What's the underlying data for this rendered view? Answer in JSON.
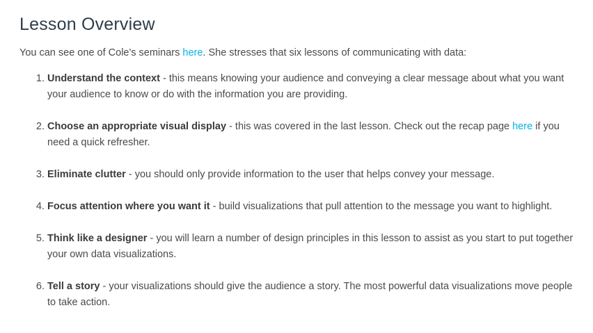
{
  "title": "Lesson Overview",
  "intro": {
    "before": "You can see one of Cole's seminars ",
    "link": "here",
    "after": ". She stresses that six lessons of communicating with data:"
  },
  "lessons": [
    {
      "title": "Understand the context",
      "text": " - this means knowing your audience and conveying a clear message about what you want your audience to know or do with the information you are providing."
    },
    {
      "title": "Choose an appropriate visual display",
      "text": " - this was covered in the last lesson. Check out the recap page ",
      "link": "here",
      "after": " if you need a quick refresher."
    },
    {
      "title": "Eliminate clutter",
      "text": " - you should only provide information to the user that helps convey your message."
    },
    {
      "title": "Focus attention where you want it",
      "text": " - build visualizations that pull attention to the message you want to highlight."
    },
    {
      "title": "Think like a designer",
      "text": " - you will learn a number of design principles in this lesson to assist as you start to put together your own data visualizations."
    },
    {
      "title": "Tell a story",
      "text": " - your visualizations should give the audience a story. The most powerful data visualizations move people to take action."
    }
  ],
  "colors": {
    "link": "#02b3e4",
    "heading": "#2e3d49",
    "body_text": "#4a4a4a"
  }
}
